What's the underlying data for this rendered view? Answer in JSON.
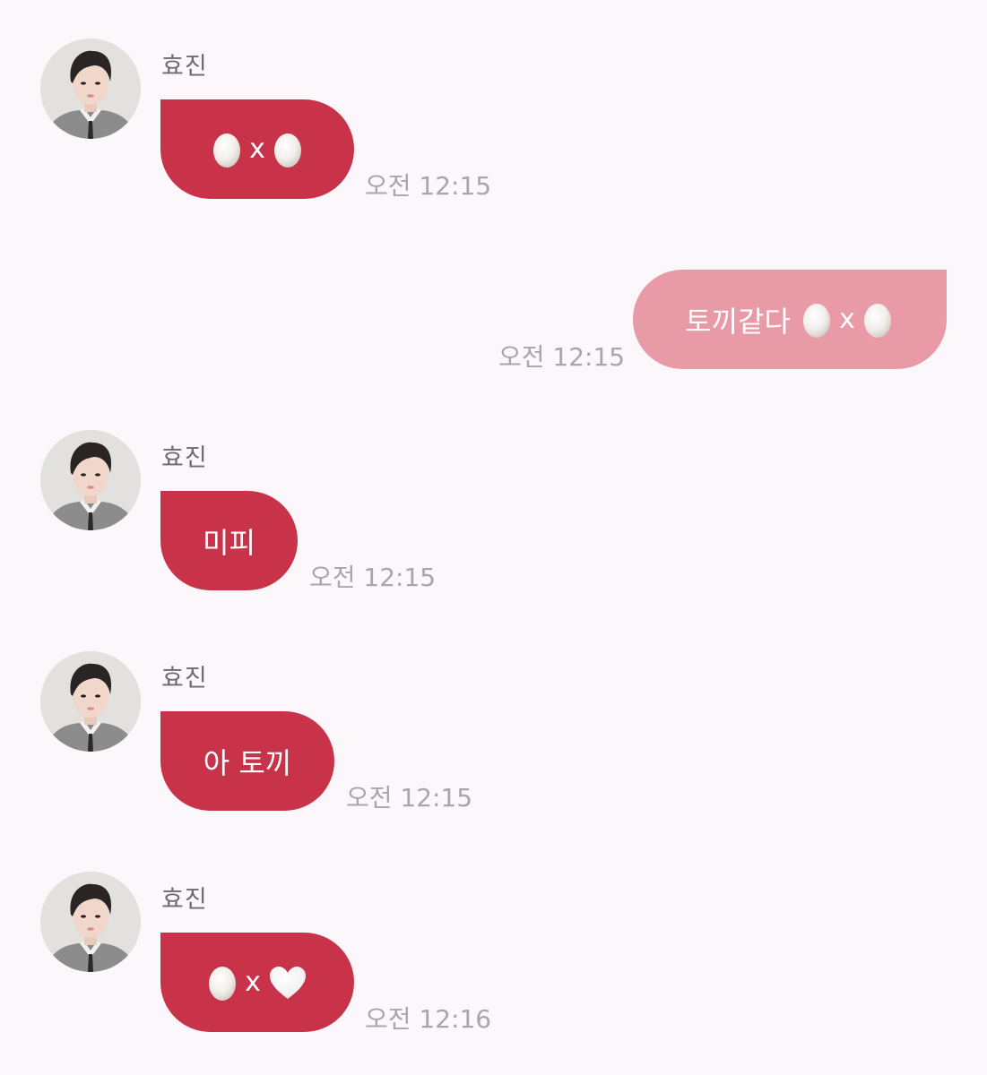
{
  "messages": [
    {
      "direction": "incoming",
      "sender": "효진",
      "text": "",
      "parts": [
        "egg-icon",
        "x",
        "egg-icon"
      ],
      "x_char": "x",
      "time": "오전 12:15"
    },
    {
      "direction": "outgoing",
      "text": "토끼같다 ",
      "parts": [
        "egg-icon",
        "x",
        "egg-icon"
      ],
      "x_char": "x",
      "time": "오전 12:15"
    },
    {
      "direction": "incoming",
      "sender": "효진",
      "text": "미피",
      "time": "오전 12:15"
    },
    {
      "direction": "incoming",
      "sender": "효진",
      "text": "아 토끼",
      "time": "오전 12:15"
    },
    {
      "direction": "incoming",
      "sender": "효진",
      "text": "",
      "parts": [
        "egg-icon",
        "x",
        "white-heart-icon"
      ],
      "x_char": "x",
      "time": "오전 12:16"
    }
  ],
  "colors": {
    "background": "#fcf7fa",
    "incoming_bubble": "#c9334a",
    "outgoing_bubble": "#e99aa7",
    "timestamp": "#a9a5ab",
    "sender_name": "#6f6a6f"
  }
}
